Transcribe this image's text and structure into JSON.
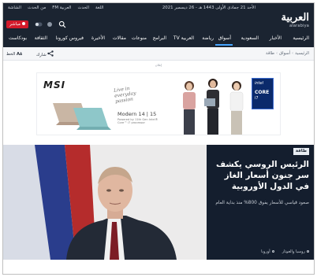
{
  "topbar": {
    "date": "الأحد 21 جمادى الأولى 1443 هـ - 26 ديسمبر 2021",
    "links": [
      "اللغة",
      "الحدث",
      "العربية FM",
      "من الحدث",
      "الشاشة"
    ]
  },
  "brand": {
    "logo_ar": "العربية",
    "logo_en": "alarabiya"
  },
  "header_controls": {
    "live_label": "مباشر"
  },
  "nav": {
    "items": [
      "الرئيسية",
      "الأخبار",
      "السعودية",
      "أسواق",
      "رياضة",
      "العربية TV",
      "البرامج",
      "منوعات",
      "مقالات",
      "الأخيرة",
      "فيروس كورونا",
      "الثقافة",
      "بودكاست"
    ],
    "active_index": 3
  },
  "breadcrumb": {
    "items": [
      "الرئيسية",
      "أسواق",
      "طاقة"
    ]
  },
  "toolbar": {
    "share_label": "شارك",
    "font_label": "الخط"
  },
  "ad": {
    "label": "إعلان",
    "brand": "MSI",
    "tagline": "Live in everyday passion",
    "model": "Modern 14 | 15",
    "sub": "Powered by 11th Gen Intel® Core™ i7 processor",
    "badge_brand": "intel",
    "badge_line1": "CORE",
    "badge_line2": "i7"
  },
  "article": {
    "tag": "طاقة",
    "headline": "الرئيس الروسي يكشف سر جنون أسعار الغاز في الدول الأوروبية",
    "summary": "صعود قياسي للأسعار يفوق 800% منذ بداية العام",
    "topics": [
      "روسيا والغوثار",
      "أوروبا"
    ]
  },
  "colors": {
    "header_bg": "#1b2431",
    "accent": "#46a5ff",
    "live_red": "#d31a2a",
    "hero_bg": "#141e2e"
  }
}
